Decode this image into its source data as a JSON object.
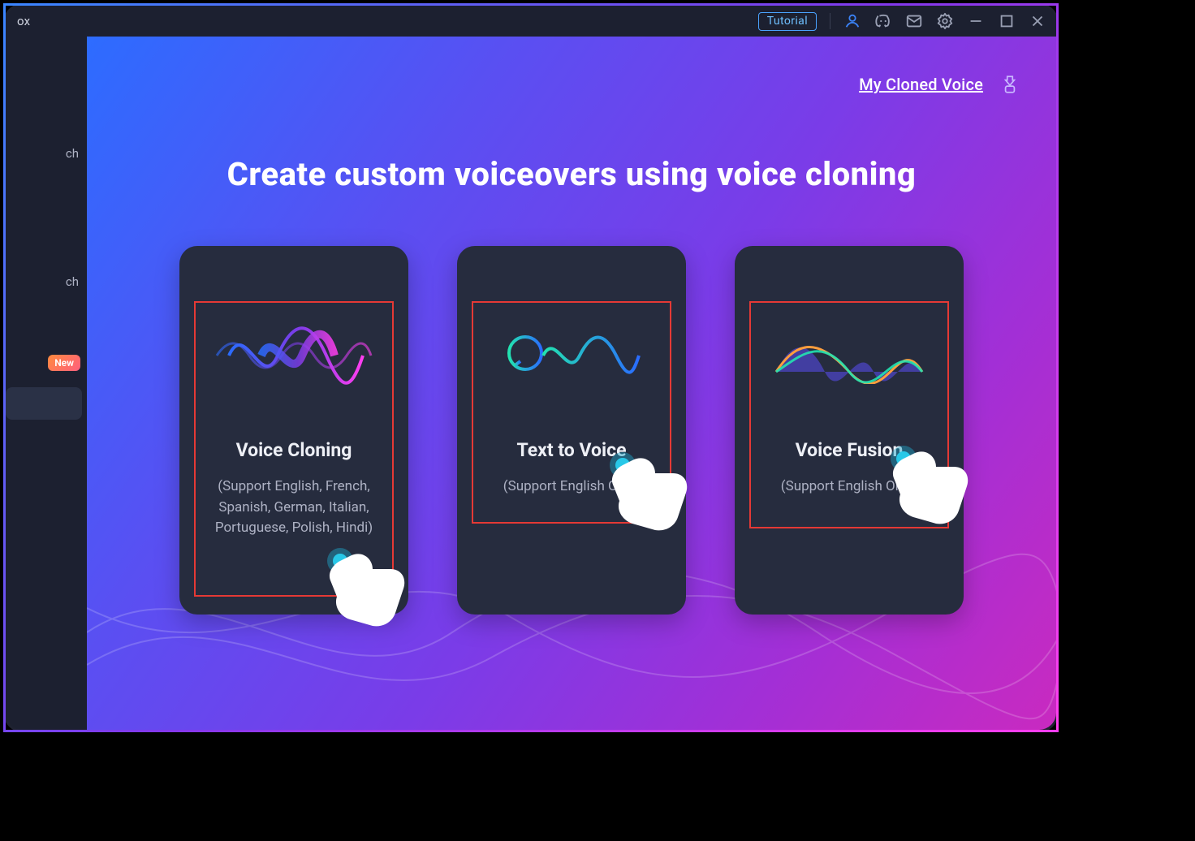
{
  "window": {
    "title_fragment": "ox"
  },
  "titlebar": {
    "tutorial_label": "Tutorial"
  },
  "sidebar": {
    "item1_fragment": "ch",
    "item2_fragment": "ch",
    "new_badge": "New"
  },
  "content": {
    "my_cloned_voice_label": "My Cloned Voice",
    "heading": "Create custom voiceovers using voice cloning",
    "cards": {
      "c1": {
        "title": "Voice Cloning",
        "subtitle": "(Support English, French, Spanish, German, Italian, Portuguese, Polish, Hindi)"
      },
      "c2": {
        "title": "Text to Voice",
        "subtitle": "(Support English Only)"
      },
      "c3": {
        "title": "Voice Fusion",
        "subtitle": "(Support English Only)"
      }
    }
  }
}
